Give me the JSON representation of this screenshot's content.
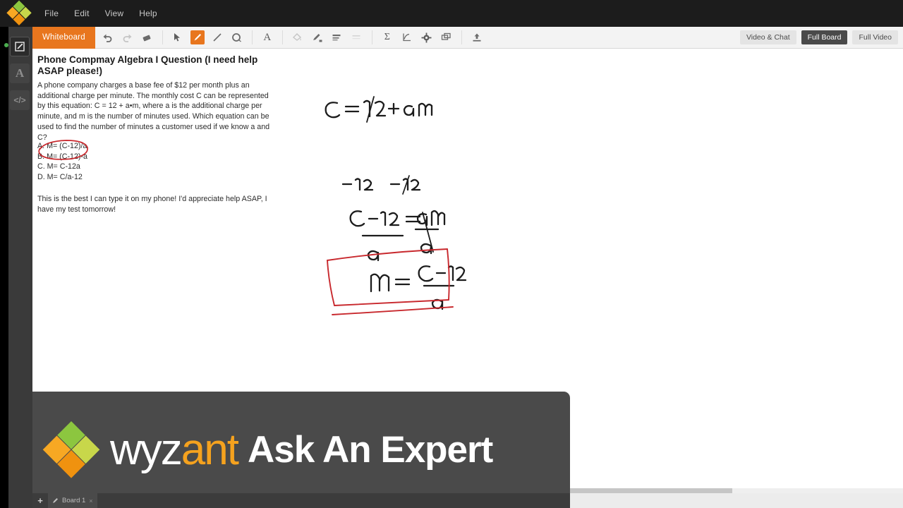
{
  "app": {
    "brand": "wyzant",
    "menu": [
      "File",
      "Edit",
      "View",
      "Help"
    ]
  },
  "sidebar": {
    "items": [
      {
        "name": "whiteboard-tool",
        "glyph": "✎",
        "active": true
      },
      {
        "name": "text-tool",
        "glyph": "A",
        "active": false
      },
      {
        "name": "code-tool",
        "glyph": "</>",
        "active": false
      }
    ]
  },
  "toolbar": {
    "whiteboard_label": "Whiteboard",
    "tools": [
      {
        "name": "undo-icon",
        "label": "Undo",
        "state": "enabled"
      },
      {
        "name": "redo-icon",
        "label": "Redo",
        "state": "disabled"
      },
      {
        "name": "eraser-icon",
        "label": "Eraser",
        "state": "enabled"
      },
      {
        "name": "select-arrow-icon",
        "label": "Select",
        "state": "enabled"
      },
      {
        "name": "pencil-icon",
        "label": "Pen",
        "state": "active"
      },
      {
        "name": "line-icon",
        "label": "Line",
        "state": "enabled"
      },
      {
        "name": "shape-ellipse-icon",
        "label": "Shape",
        "state": "enabled"
      },
      {
        "name": "text-a-icon",
        "label": "Text",
        "state": "enabled"
      },
      {
        "name": "fill-bucket-icon",
        "label": "Fill Color",
        "state": "disabled"
      },
      {
        "name": "stroke-color-icon",
        "label": "Stroke Color",
        "state": "enabled"
      },
      {
        "name": "line-weight-icon",
        "label": "Line Weight",
        "state": "enabled"
      },
      {
        "name": "line-style-icon",
        "label": "Line Style",
        "state": "disabled"
      },
      {
        "name": "sigma-math-icon",
        "label": "Math Equation",
        "state": "enabled"
      },
      {
        "name": "graph-icon",
        "label": "Graph",
        "state": "enabled"
      },
      {
        "name": "gear-icon",
        "label": "Settings",
        "state": "enabled"
      },
      {
        "name": "layers-icon",
        "label": "Layers",
        "state": "enabled"
      },
      {
        "name": "upload-icon",
        "label": "Upload",
        "state": "enabled"
      }
    ],
    "view_buttons": [
      {
        "label": "Video & Chat",
        "selected": false
      },
      {
        "label": "Full Board",
        "selected": true
      },
      {
        "label": "Full Video",
        "selected": false
      }
    ]
  },
  "board": {
    "title": "Phone Compmay Algebra I Question (I need help ASAP please!)",
    "body": "A phone company charges a base fee of $12 per month plus an additional charge per minute. The monthly cost C can be represented by this equation: C = 12 + a•m, where a is the additional charge per minute, and m is the number of minutes used. Which equation can be used to find the number of minutes a customer used if we know a and C?",
    "choices": [
      "A. M= (C-12)/a",
      "B. M= (C-12)-a",
      "C. M= C-12a",
      "D. M= C/a-12"
    ],
    "footer": "This is the best I can type it on my phone! I'd appreciate help ASAP, I have my test tomorrow!",
    "annotations": {
      "circled_choice": "A. M= (C-12)/a",
      "work_line_1": "C = 12 + aM",
      "work_line_2": "-12   -12",
      "work_line_3": "(C-12)/a = aM/a",
      "boxed_answer": "M = (C-12)/a",
      "ink_color_black": "#1a1a1a",
      "ink_color_red": "#c8282d"
    }
  },
  "overlay": {
    "brand_part1": "wyz",
    "brand_part2": "ant",
    "tagline": "Ask An Expert"
  },
  "bottom": {
    "add_label": "+",
    "tabs": [
      {
        "label": "Board 1",
        "close": "×"
      }
    ]
  }
}
